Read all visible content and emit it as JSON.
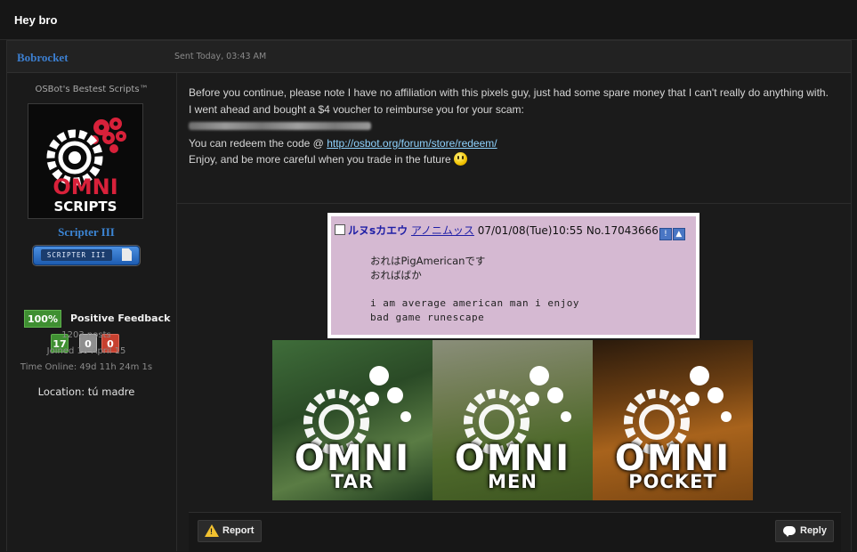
{
  "topic": {
    "title": "Hey bro"
  },
  "post": {
    "author": "Bobrocket",
    "sent": "Sent Today, 03:43 AM"
  },
  "profile": {
    "title": "OSBot's Bestest Scripts™",
    "avatar_text": [
      "OMNI",
      "SCRIPTS"
    ],
    "rank": "Scripter III",
    "rank_badge": "SCRIPTER III",
    "feedback_percent": "100%",
    "feedback_label": "Positive Feedback",
    "feedback_positive": "17",
    "feedback_neutral": "0",
    "feedback_negative": "0",
    "posts": "1203 posts",
    "joined": "Joined 10-April 15",
    "time_online": "Time Online: 49d 11h 24m 1s",
    "location": "Location: tú madre"
  },
  "message": {
    "line1": "Before you continue, please note I have no affiliation with this pixels guy, just had some spare money that I can't really do anything with.",
    "line2": "I went ahead and bought a $4 voucher to reimburse you for your scam:",
    "redeem_prefix": "You can redeem the code @ ",
    "redeem_link": "http://osbot.org/forum/store/redeem/",
    "line4": "Enjoy, and be more careful when you trade in the future"
  },
  "chan_post": {
    "subject": "ルヌsカエウ",
    "name": "アノニムッス",
    "meta": "07/01/08(Tue)10:55 No.17043666",
    "body_jp": [
      "おれはPigAmericanです",
      "おればばか"
    ],
    "body_en": [
      "i am average american man i enjoy",
      "bad game runescape"
    ]
  },
  "banners": [
    {
      "word": "OMNI",
      "sub": "TAR"
    },
    {
      "word": "OMNI",
      "sub": "MEN"
    },
    {
      "word": "OMNI",
      "sub": "POCKET"
    }
  ],
  "actions": {
    "report": "Report",
    "reply": "Reply"
  },
  "colors": {
    "link": "#3c7fd0",
    "positive": "#3f8f32",
    "negative": "#c7402f",
    "neutral": "#8f8f8f"
  }
}
